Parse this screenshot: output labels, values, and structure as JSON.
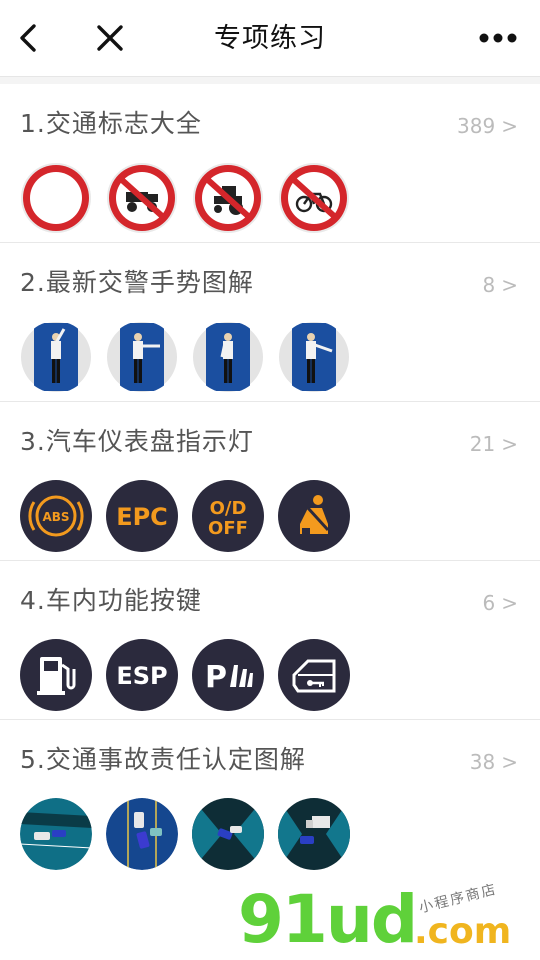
{
  "header": {
    "title": "专项练习",
    "back_icon": "chevron-left-icon",
    "close_icon": "close-icon",
    "more_icon": "more-dots-icon"
  },
  "sections": [
    {
      "title": "1.交通标志大全",
      "count": "389",
      "chevron": ">",
      "thumbs": [
        "no-entry-sign-icon",
        "no-tricycle-sign-icon",
        "no-tractor-sign-icon",
        "no-bicycle-sign-icon"
      ]
    },
    {
      "title": "2.最新交警手势图解",
      "count": "8",
      "chevron": ">",
      "thumbs": [
        "police-gesture-stop",
        "police-gesture-left-turn",
        "police-gesture-straight",
        "police-gesture-right-turn"
      ]
    },
    {
      "title": "3.汽车仪表盘指示灯",
      "count": "21",
      "chevron": ">",
      "thumbs": [
        "abs-indicator-icon",
        "epc-indicator-icon",
        "od-off-indicator-icon",
        "seatbelt-indicator-icon"
      ],
      "labels": {
        "abs": "ABS",
        "epc": "EPC",
        "od": "O/D",
        "off": "OFF"
      }
    },
    {
      "title": "4.车内功能按键",
      "count": "6",
      "chevron": ">",
      "thumbs": [
        "fuel-icon",
        "esp-icon",
        "parking-sensor-icon",
        "door-lock-icon"
      ],
      "labels": {
        "esp": "ESP",
        "park": "P"
      }
    },
    {
      "title": "5.交通事故责任认定图解",
      "count": "38",
      "chevron": ">",
      "thumbs": [
        "accident-scene-1",
        "accident-scene-2",
        "accident-scene-3",
        "accident-scene-4"
      ]
    }
  ],
  "watermark": {
    "brand": "91ud",
    "domain": ".com",
    "tagline": "小程序商店"
  },
  "colors": {
    "sign_red": "#d4262b",
    "indicator_orange": "#f39a1e",
    "indicator_bg": "#2b2a3d",
    "police_bg": "#1b4fa0",
    "accident_bg": "#0f6f86"
  }
}
